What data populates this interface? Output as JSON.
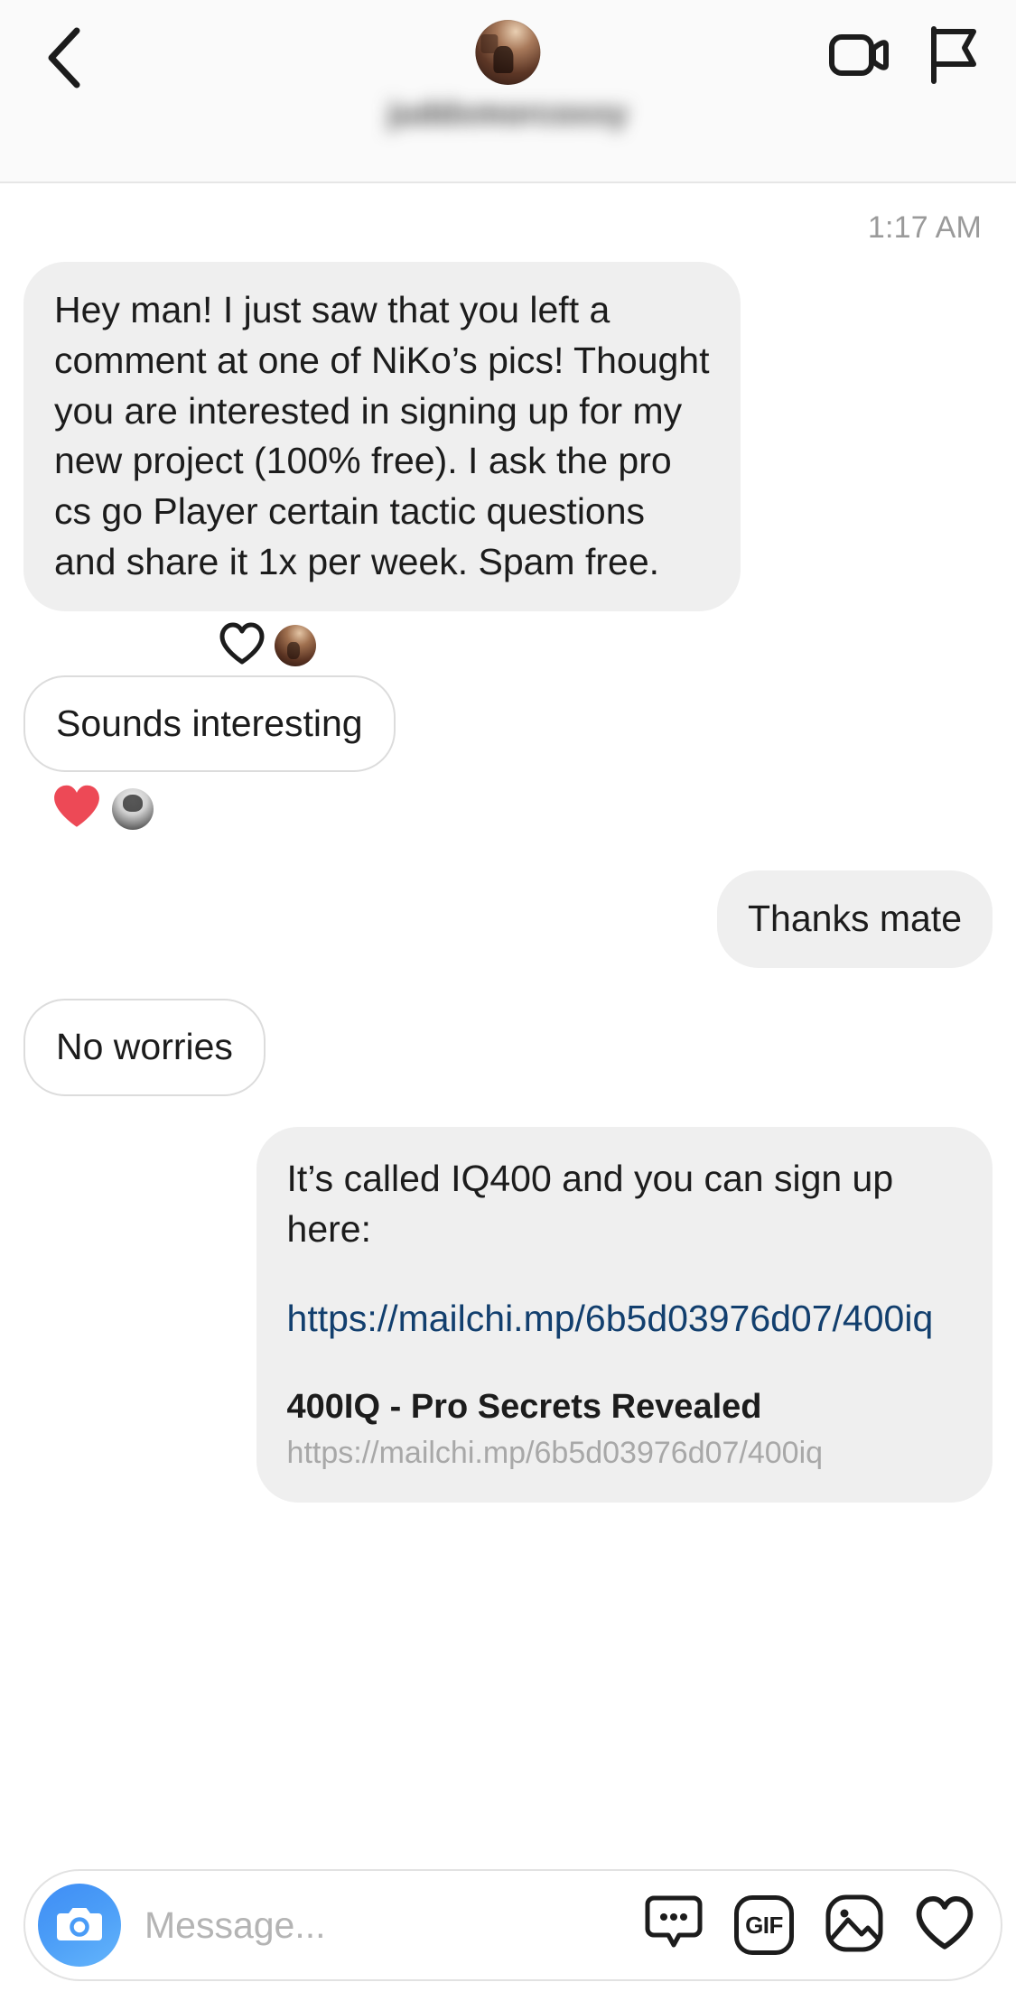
{
  "header": {
    "back_icon": "chevron-left-icon",
    "username": "juddxmorcoxxy",
    "avatar_alt": "conversation-partner-avatar",
    "video_call_icon": "video-camera-icon",
    "flag_icon": "flag-icon"
  },
  "thread": {
    "timestamp": "1:17 AM",
    "messages": [
      {
        "id": "msg-1",
        "side": "incoming",
        "style": "filled",
        "text": "Hey man! I just saw that you left a comment at one of NiKo’s pics! Thought you are interested in signing up for my new project (100% free). I ask the pro cs go Player certain tactic questions and share it 1x per week. Spam free."
      },
      {
        "id": "msg-2",
        "side": "incoming",
        "style": "outlined",
        "text": "Sounds interesting"
      },
      {
        "id": "msg-3",
        "side": "outgoing",
        "style": "filled",
        "text": "Thanks mate"
      },
      {
        "id": "msg-4",
        "side": "incoming",
        "style": "outlined",
        "text": "No worries"
      }
    ],
    "reactions": [
      {
        "id": "reaction-1",
        "icon": "heart-outline-icon",
        "filled": false,
        "color": "#1c1c1c",
        "avatar": "sender-avatar"
      },
      {
        "id": "reaction-2",
        "icon": "heart-filled-icon",
        "filled": true,
        "color": "#ED4956",
        "avatar": "my-avatar"
      }
    ],
    "link_message": {
      "intro": "It’s called IQ400 and you can sign up here:",
      "url_text": "https://mailchi.mp/6b5d03976d07/400iq",
      "url_color": "#123f6e",
      "preview_title": "400IQ - Pro Secrets Revealed",
      "preview_url": "https://mailchi.mp/6b5d03976d07/400iq"
    }
  },
  "composer": {
    "camera_icon": "camera-icon",
    "placeholder": "Message...",
    "input_value": "",
    "icons": [
      {
        "name": "sticker-icon",
        "label": ""
      },
      {
        "name": "gif-icon",
        "label": "GIF"
      },
      {
        "name": "photo-icon",
        "label": ""
      },
      {
        "name": "heart-icon",
        "label": ""
      }
    ]
  },
  "colors": {
    "bubble_filled": "#efefef",
    "bubble_outline_border": "#dcdcdc",
    "heart_red": "#ED4956",
    "link_blue": "#123f6e",
    "camera_blue": "#4a9cf7",
    "timestamp_gray": "#9a9a9a"
  }
}
